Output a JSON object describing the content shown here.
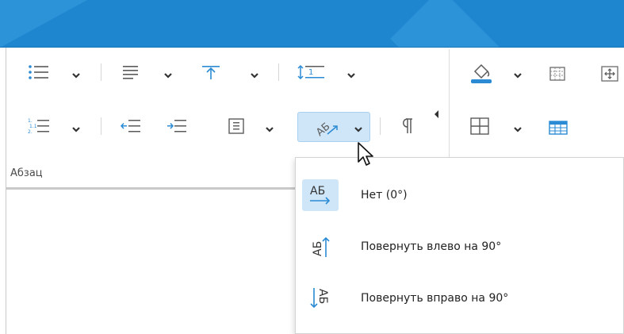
{
  "ribbon": {
    "paragraph_group_label": "Абзац"
  },
  "rotate_menu": {
    "items": [
      {
        "label": "Нет (0°)",
        "icon": "text-direction-none-icon",
        "selected": true
      },
      {
        "label": "Повернуть влево на 90°",
        "icon": "text-rotate-left-icon",
        "selected": false
      },
      {
        "label": "Повернуть вправо на 90°",
        "icon": "text-rotate-right-icon",
        "selected": false
      }
    ],
    "icon_text": "АБ"
  },
  "colors": {
    "accent_blue": "#1d86cf",
    "icon_blue": "#2a8bd4",
    "icon_gray": "#5a5a5a",
    "selection_bg": "#cfe6f8"
  }
}
